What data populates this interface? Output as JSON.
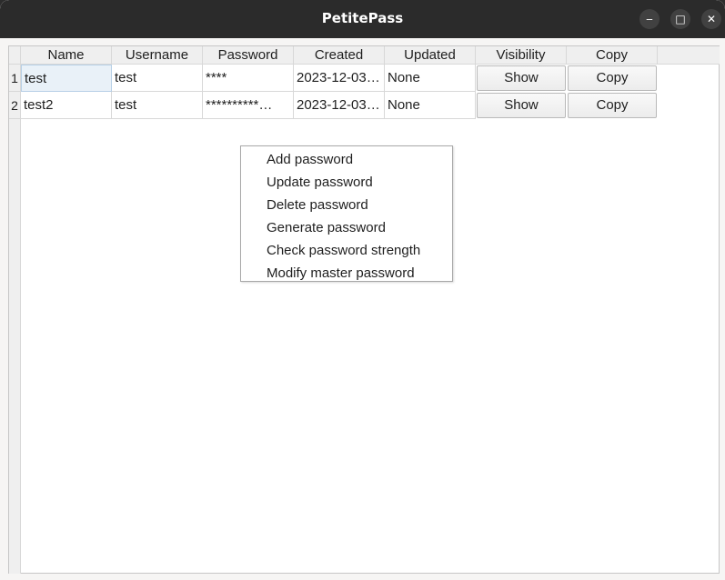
{
  "window": {
    "title": "PetitePass",
    "minimize_glyph": "‒",
    "maximize_glyph": "□",
    "close_glyph": "✕"
  },
  "table": {
    "columns": [
      "Name",
      "Username",
      "Password",
      "Created",
      "Updated",
      "Visibility",
      "Copy"
    ],
    "rows": [
      {
        "num": "1",
        "name": "test",
        "username": "test",
        "password": "****",
        "created": "2023-12-03…",
        "updated": "None",
        "visibility_button": "Show",
        "copy_button": "Copy"
      },
      {
        "num": "2",
        "name": "test2",
        "username": "test",
        "password": "**********…",
        "created": "2023-12-03…",
        "updated": "None",
        "visibility_button": "Show",
        "copy_button": "Copy"
      }
    ]
  },
  "context_menu": {
    "items": [
      "Add password",
      "Update password",
      "Delete password",
      "Generate password",
      "Check password strength",
      "Modify master password"
    ]
  }
}
